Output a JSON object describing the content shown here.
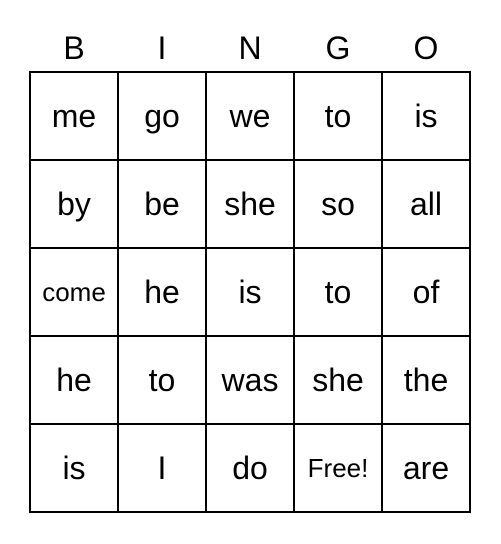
{
  "header": [
    "B",
    "I",
    "N",
    "G",
    "O"
  ],
  "grid": [
    [
      "me",
      "go",
      "we",
      "to",
      "is"
    ],
    [
      "by",
      "be",
      "she",
      "so",
      "all"
    ],
    [
      "come",
      "he",
      "is",
      "to",
      "of"
    ],
    [
      "he",
      "to",
      "was",
      "she",
      "the"
    ],
    [
      "is",
      "I",
      "do",
      "Free!",
      "are"
    ]
  ]
}
